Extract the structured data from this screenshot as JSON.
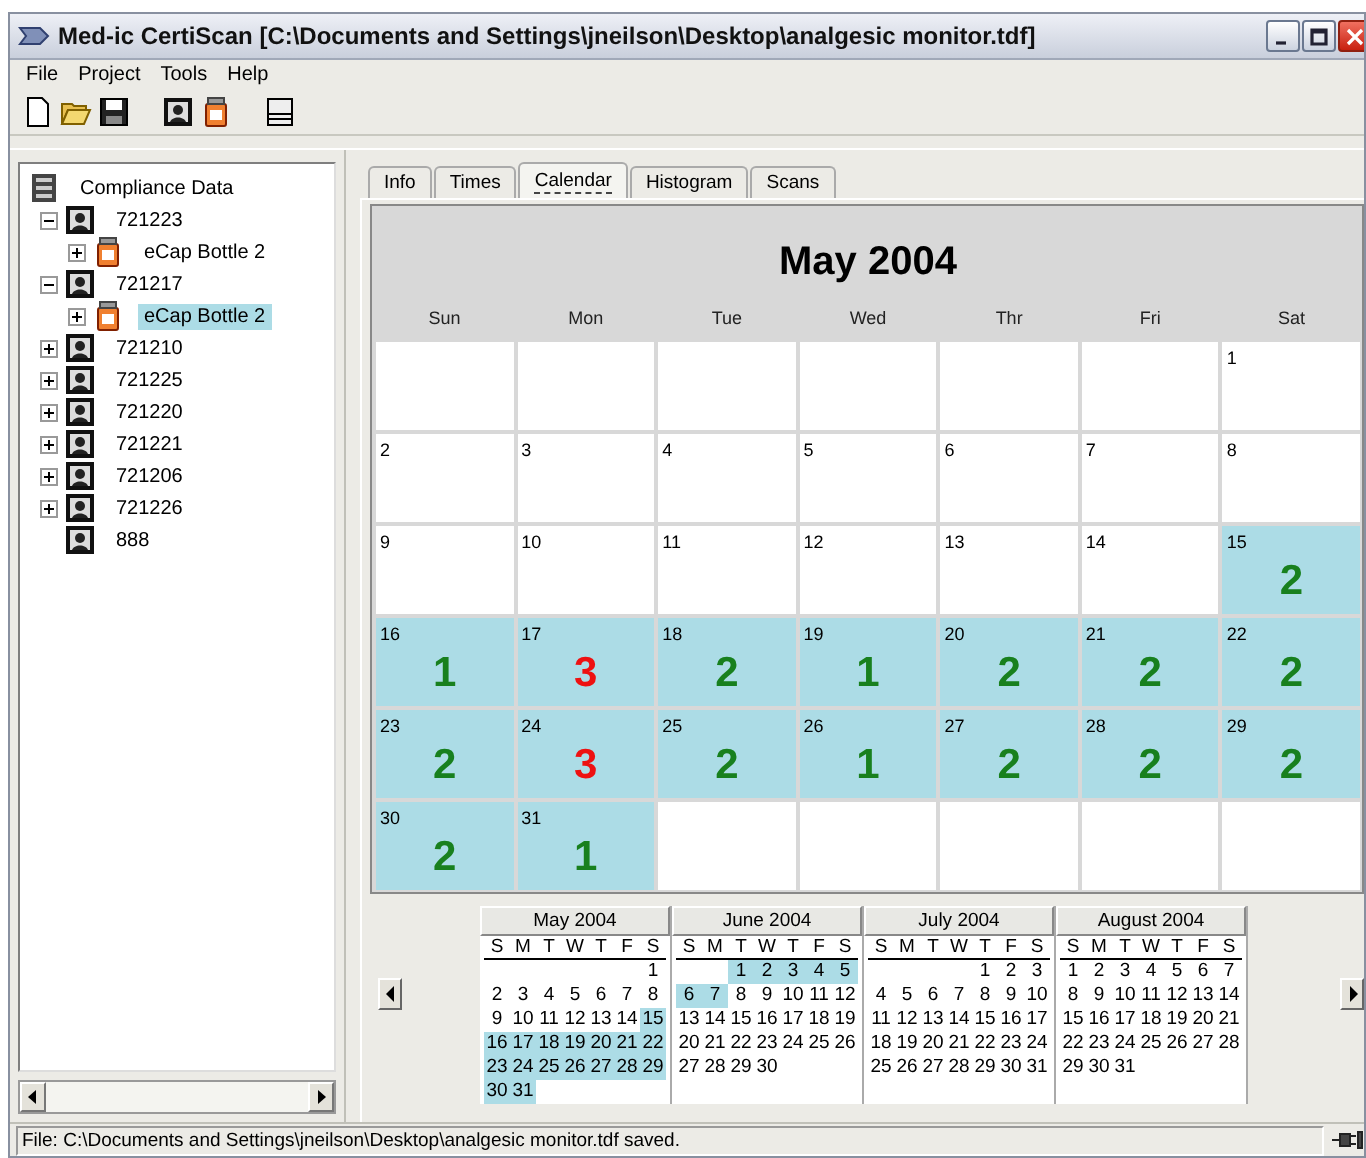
{
  "window": {
    "title": "Med-ic CertiScan [C:\\Documents and Settings\\jneilson\\Desktop\\analgesic monitor.tdf]"
  },
  "menu": [
    {
      "label": "File"
    },
    {
      "label": "Project"
    },
    {
      "label": "Tools"
    },
    {
      "label": "Help"
    }
  ],
  "toolbar": [
    {
      "kind": "new"
    },
    {
      "kind": "open"
    },
    {
      "kind": "save"
    },
    {
      "kind": "gap"
    },
    {
      "kind": "patient"
    },
    {
      "kind": "bottle"
    },
    {
      "kind": "gap"
    },
    {
      "kind": "drive"
    }
  ],
  "tree": {
    "label": "Compliance Data",
    "children": [
      {
        "label": "721223",
        "kind": "patient",
        "expanded": true,
        "selected": false,
        "children": [
          {
            "label": "eCap Bottle 2",
            "kind": "bottle",
            "expanded": false,
            "selected": false
          }
        ]
      },
      {
        "label": "721217",
        "kind": "patient",
        "expanded": true,
        "selected": false,
        "children": [
          {
            "label": "eCap Bottle 2",
            "kind": "bottle",
            "expanded": false,
            "selected": true
          }
        ]
      },
      {
        "label": "721210",
        "kind": "patient",
        "expanded": false,
        "selected": false
      },
      {
        "label": "721225",
        "kind": "patient",
        "expanded": false,
        "selected": false
      },
      {
        "label": "721220",
        "kind": "patient",
        "expanded": false,
        "selected": false
      },
      {
        "label": "721221",
        "kind": "patient",
        "expanded": false,
        "selected": false
      },
      {
        "label": "721206",
        "kind": "patient",
        "expanded": false,
        "selected": false
      },
      {
        "label": "721226",
        "kind": "patient",
        "expanded": false,
        "selected": false
      },
      {
        "label": "888",
        "kind": "patient",
        "selected": false
      }
    ]
  },
  "tabs": [
    {
      "label": "Info",
      "selected": false
    },
    {
      "label": "Times",
      "selected": false
    },
    {
      "label": "Calendar",
      "selected": true
    },
    {
      "label": "Histogram",
      "selected": false
    },
    {
      "label": "Scans",
      "selected": false
    }
  ],
  "calendar": {
    "title": "May 2004",
    "weekdays": [
      "Sun",
      "Mon",
      "Tue",
      "Wed",
      "Thr",
      "Fri",
      "Sat"
    ],
    "weeks": [
      {
        "kind": "leading",
        "days": [
          {
            "day": "1"
          }
        ]
      },
      {
        "days": [
          {
            "day": "2"
          },
          {
            "day": "3"
          },
          {
            "day": "4"
          },
          {
            "day": "5"
          },
          {
            "day": "6"
          },
          {
            "day": "7"
          },
          {
            "day": "8"
          }
        ]
      },
      {
        "days": [
          {
            "day": "9"
          },
          {
            "day": "10"
          },
          {
            "day": "11"
          },
          {
            "day": "12"
          },
          {
            "day": "13"
          },
          {
            "day": "14"
          },
          {
            "day": "15",
            "count": "2",
            "color": "#18801e"
          }
        ]
      },
      {
        "days": [
          {
            "day": "16",
            "count": "1",
            "color": "#18801e"
          },
          {
            "day": "17",
            "count": "3",
            "color": "#ee1111"
          },
          {
            "day": "18",
            "count": "2",
            "color": "#18801e"
          },
          {
            "day": "19",
            "count": "1",
            "color": "#18801e"
          },
          {
            "day": "20",
            "count": "2",
            "color": "#18801e"
          },
          {
            "day": "21",
            "count": "2",
            "color": "#18801e"
          },
          {
            "day": "22",
            "count": "2",
            "color": "#18801e"
          }
        ]
      },
      {
        "days": [
          {
            "day": "23",
            "count": "2",
            "color": "#18801e"
          },
          {
            "day": "24",
            "count": "3",
            "color": "#ee1111"
          },
          {
            "day": "25",
            "count": "2",
            "color": "#18801e"
          },
          {
            "day": "26",
            "count": "1",
            "color": "#18801e"
          },
          {
            "day": "27",
            "count": "2",
            "color": "#18801e"
          },
          {
            "day": "28",
            "count": "2",
            "color": "#18801e"
          },
          {
            "day": "29",
            "count": "2",
            "color": "#18801e"
          }
        ]
      },
      {
        "days": [
          {
            "day": "30",
            "count": "2",
            "color": "#18801e"
          },
          {
            "day": "31",
            "count": "1",
            "color": "#18801e"
          }
        ]
      }
    ]
  },
  "mini_calendars": [
    {
      "title": "May 2004",
      "weekdays": [
        "S",
        "M",
        "T",
        "W",
        "T",
        "F",
        "S"
      ],
      "weeks": [
        {
          "kind": "leading",
          "days": [
            {
              "day": "1",
              "marked": false
            }
          ]
        },
        {
          "days": [
            {
              "day": "2",
              "marked": false
            },
            {
              "day": "3",
              "marked": false
            },
            {
              "day": "4",
              "marked": false
            },
            {
              "day": "5",
              "marked": false
            },
            {
              "day": "6",
              "marked": false
            },
            {
              "day": "7",
              "marked": false
            },
            {
              "day": "8",
              "marked": false
            }
          ]
        },
        {
          "days": [
            {
              "day": "9",
              "marked": false
            },
            {
              "day": "10",
              "marked": false
            },
            {
              "day": "11",
              "marked": false
            },
            {
              "day": "12",
              "marked": false
            },
            {
              "day": "13",
              "marked": false
            },
            {
              "day": "14",
              "marked": false
            },
            {
              "day": "15",
              "marked": true
            }
          ]
        },
        {
          "days": [
            {
              "day": "16",
              "marked": true
            },
            {
              "day": "17",
              "marked": true
            },
            {
              "day": "18",
              "marked": true
            },
            {
              "day": "19",
              "marked": true
            },
            {
              "day": "20",
              "marked": true
            },
            {
              "day": "21",
              "marked": true
            },
            {
              "day": "22",
              "marked": true
            }
          ]
        },
        {
          "days": [
            {
              "day": "23",
              "marked": true
            },
            {
              "day": "24",
              "marked": true
            },
            {
              "day": "25",
              "marked": true
            },
            {
              "day": "26",
              "marked": true
            },
            {
              "day": "27",
              "marked": true
            },
            {
              "day": "28",
              "marked": true
            },
            {
              "day": "29",
              "marked": true
            }
          ]
        },
        {
          "days": [
            {
              "day": "30",
              "marked": true
            },
            {
              "day": "31",
              "marked": true
            }
          ]
        }
      ]
    },
    {
      "title": "June 2004",
      "weekdays": [
        "S",
        "M",
        "T",
        "W",
        "T",
        "F",
        "S"
      ],
      "weeks": [
        {
          "kind": "leading",
          "days": [
            {
              "day": "1",
              "marked": true
            },
            {
              "day": "2",
              "marked": true
            },
            {
              "day": "3",
              "marked": true
            },
            {
              "day": "4",
              "marked": true
            },
            {
              "day": "5",
              "marked": true
            }
          ]
        },
        {
          "days": [
            {
              "day": "6",
              "marked": true
            },
            {
              "day": "7",
              "marked": true
            },
            {
              "day": "8",
              "marked": false
            },
            {
              "day": "9",
              "marked": false
            },
            {
              "day": "10",
              "marked": false
            },
            {
              "day": "11",
              "marked": false
            },
            {
              "day": "12",
              "marked": false
            }
          ]
        },
        {
          "days": [
            {
              "day": "13",
              "marked": false
            },
            {
              "day": "14",
              "marked": false
            },
            {
              "day": "15",
              "marked": false
            },
            {
              "day": "16",
              "marked": false
            },
            {
              "day": "17",
              "marked": false
            },
            {
              "day": "18",
              "marked": false
            },
            {
              "day": "19",
              "marked": false
            }
          ]
        },
        {
          "days": [
            {
              "day": "20",
              "marked": false
            },
            {
              "day": "21",
              "marked": false
            },
            {
              "day": "22",
              "marked": false
            },
            {
              "day": "23",
              "marked": false
            },
            {
              "day": "24",
              "marked": false
            },
            {
              "day": "25",
              "marked": false
            },
            {
              "day": "26",
              "marked": false
            }
          ]
        },
        {
          "days": [
            {
              "day": "27",
              "marked": false
            },
            {
              "day": "28",
              "marked": false
            },
            {
              "day": "29",
              "marked": false
            },
            {
              "day": "30",
              "marked": false
            }
          ]
        }
      ]
    },
    {
      "title": "July 2004",
      "weekdays": [
        "S",
        "M",
        "T",
        "W",
        "T",
        "F",
        "S"
      ],
      "weeks": [
        {
          "kind": "leading",
          "days": [
            {
              "day": "1",
              "marked": false
            },
            {
              "day": "2",
              "marked": false
            },
            {
              "day": "3",
              "marked": false
            }
          ]
        },
        {
          "days": [
            {
              "day": "4",
              "marked": false
            },
            {
              "day": "5",
              "marked": false
            },
            {
              "day": "6",
              "marked": false
            },
            {
              "day": "7",
              "marked": false
            },
            {
              "day": "8",
              "marked": false
            },
            {
              "day": "9",
              "marked": false
            },
            {
              "day": "10",
              "marked": false
            }
          ]
        },
        {
          "days": [
            {
              "day": "11",
              "marked": false
            },
            {
              "day": "12",
              "marked": false
            },
            {
              "day": "13",
              "marked": false
            },
            {
              "day": "14",
              "marked": false
            },
            {
              "day": "15",
              "marked": false
            },
            {
              "day": "16",
              "marked": false
            },
            {
              "day": "17",
              "marked": false
            }
          ]
        },
        {
          "days": [
            {
              "day": "18",
              "marked": false
            },
            {
              "day": "19",
              "marked": false
            },
            {
              "day": "20",
              "marked": false
            },
            {
              "day": "21",
              "marked": false
            },
            {
              "day": "22",
              "marked": false
            },
            {
              "day": "23",
              "marked": false
            },
            {
              "day": "24",
              "marked": false
            }
          ]
        },
        {
          "days": [
            {
              "day": "25",
              "marked": false
            },
            {
              "day": "26",
              "marked": false
            },
            {
              "day": "27",
              "marked": false
            },
            {
              "day": "28",
              "marked": false
            },
            {
              "day": "29",
              "marked": false
            },
            {
              "day": "30",
              "marked": false
            },
            {
              "day": "31",
              "marked": false
            }
          ]
        }
      ]
    },
    {
      "title": "August 2004",
      "weekdays": [
        "S",
        "M",
        "T",
        "W",
        "T",
        "F",
        "S"
      ],
      "weeks": [
        {
          "days": [
            {
              "day": "1",
              "marked": false
            },
            {
              "day": "2",
              "marked": false
            },
            {
              "day": "3",
              "marked": false
            },
            {
              "day": "4",
              "marked": false
            },
            {
              "day": "5",
              "marked": false
            },
            {
              "day": "6",
              "marked": false
            },
            {
              "day": "7",
              "marked": false
            }
          ]
        },
        {
          "days": [
            {
              "day": "8",
              "marked": false
            },
            {
              "day": "9",
              "marked": false
            },
            {
              "day": "10",
              "marked": false
            },
            {
              "day": "11",
              "marked": false
            },
            {
              "day": "12",
              "marked": false
            },
            {
              "day": "13",
              "marked": false
            },
            {
              "day": "14",
              "marked": false
            }
          ]
        },
        {
          "days": [
            {
              "day": "15",
              "marked": false
            },
            {
              "day": "16",
              "marked": false
            },
            {
              "day": "17",
              "marked": false
            },
            {
              "day": "18",
              "marked": false
            },
            {
              "day": "19",
              "marked": false
            },
            {
              "day": "20",
              "marked": false
            },
            {
              "day": "21",
              "marked": false
            }
          ]
        },
        {
          "days": [
            {
              "day": "22",
              "marked": false
            },
            {
              "day": "23",
              "marked": false
            },
            {
              "day": "24",
              "marked": false
            },
            {
              "day": "25",
              "marked": false
            },
            {
              "day": "26",
              "marked": false
            },
            {
              "day": "27",
              "marked": false
            },
            {
              "day": "28",
              "marked": false
            }
          ]
        },
        {
          "days": [
            {
              "day": "29",
              "marked": false
            },
            {
              "day": "30",
              "marked": false
            },
            {
              "day": "31",
              "marked": false
            }
          ]
        }
      ]
    }
  ],
  "status_bar": {
    "text": "File: C:\\Documents and Settings\\jneilson\\Desktop\\analgesic monitor.tdf saved."
  }
}
